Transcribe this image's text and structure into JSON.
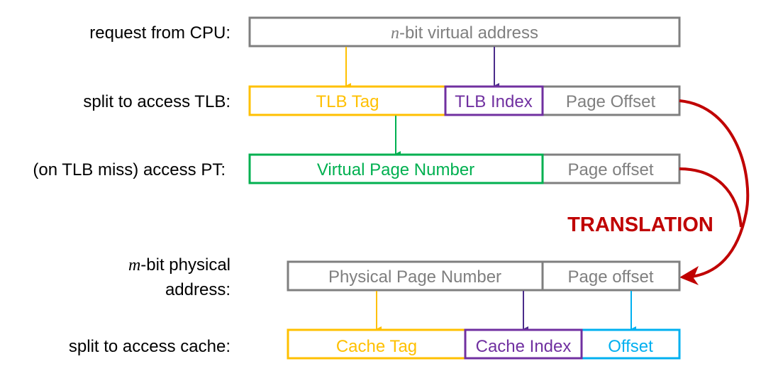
{
  "colors": {
    "gray": "#7F7F7F",
    "yellow": "#FFC000",
    "purple": "#7030A0",
    "darkpurple": "#4B2C8A",
    "green": "#00B050",
    "blue": "#00B0F0",
    "red": "#C00000"
  },
  "rows": {
    "cpu": {
      "label": "request from CPU:",
      "var": "n",
      "field": "-bit virtual address"
    },
    "tlb": {
      "label": "split to access TLB:",
      "tag": "TLB Tag",
      "index": "TLB Index",
      "offset": "Page Offset"
    },
    "pt": {
      "label": "(on TLB miss) access PT:",
      "vpn": "Virtual Page Number",
      "offset": "Page offset"
    },
    "phys": {
      "label_var": "m",
      "label_line1": "-bit physical",
      "label_line2": "address:",
      "ppn": "Physical Page Number",
      "offset": "Page offset"
    },
    "cache": {
      "label": "split to access cache:",
      "tag": "Cache Tag",
      "index": "Cache Index",
      "offset": "Offset"
    }
  },
  "translation_label": "TRANSLATION"
}
